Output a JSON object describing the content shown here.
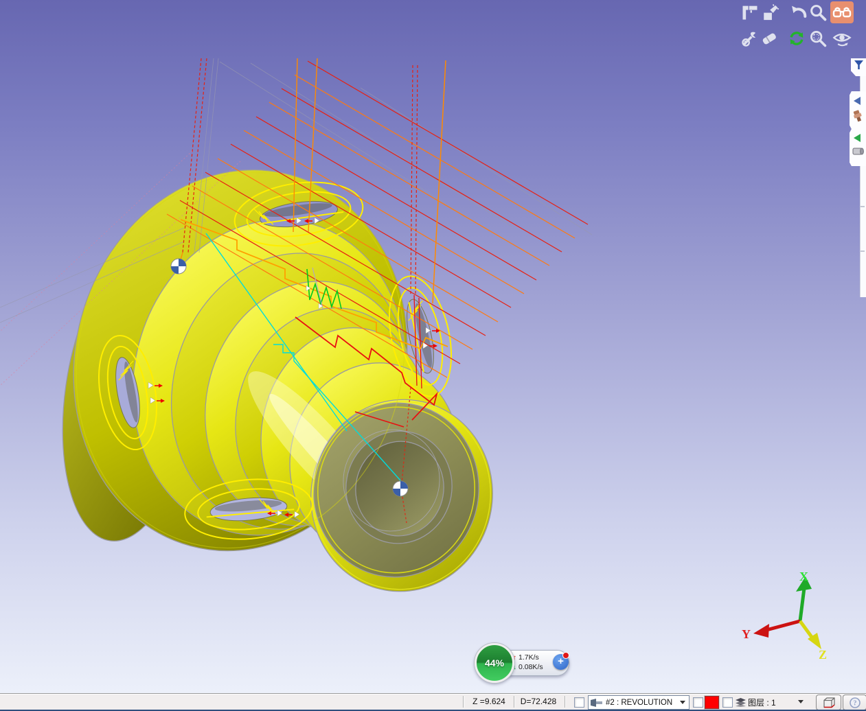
{
  "viewport": {
    "background_top": "#6767b1",
    "background_bottom": "#ecf0fa",
    "part_color": "#d8d800",
    "axis_triad": {
      "x_label": "X",
      "y_label": "Y",
      "z_label": "Z",
      "x_color": "#22cc22",
      "y_color": "#dd2222",
      "z_color": "#cccc00"
    },
    "toolpath_colors": {
      "cut": "#e82010",
      "lead": "#ff8a00",
      "link": "#00dcdc",
      "plunge": "#00c81e",
      "contour": "#ffff00",
      "rapid": "#9898b0"
    }
  },
  "toolbar": {
    "rows": [
      {
        "icons": [
          "measure-caliper",
          "clean-tool",
          "undo",
          "zoom",
          "view-glasses"
        ]
      },
      {
        "icons": [
          "tool-settings",
          "eraser",
          "refresh-view",
          "zoom-extents",
          "rotate-view"
        ]
      }
    ],
    "active_icon": "view-glasses",
    "active_bg": "#e88f6e"
  },
  "side_panel": {
    "tabs": [
      {
        "icons": [
          "filter-funnel"
        ]
      },
      {
        "icons": [
          "collapse-left-blue",
          "tool-nozzle"
        ]
      },
      {
        "icons": [
          "collapse-left-green",
          "stock-cylinder"
        ]
      }
    ]
  },
  "status_bar": {
    "z_readout": "Z =9.624",
    "d_readout": "D=72.428",
    "tool_selector": {
      "value": "#2 : REVOLUTION"
    },
    "color_swatch": "#ff0000",
    "layer": {
      "label": "图层 : 1"
    },
    "buttons": [
      "wireframe-box",
      "help"
    ]
  },
  "overlay_badge": {
    "percent": "44%",
    "upload_speed": "1.7K/s",
    "download_speed": "0.08K/s",
    "plus_label": "+"
  }
}
